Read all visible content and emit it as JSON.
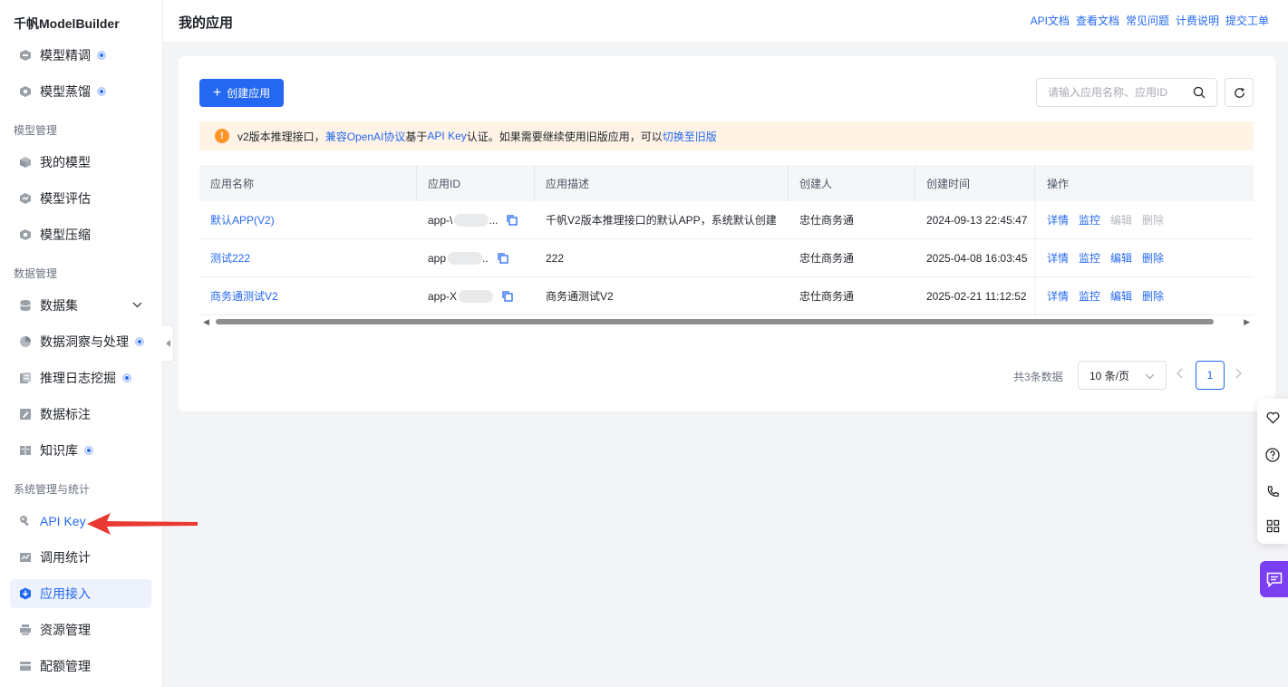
{
  "sidebar": {
    "brand": "千帆ModelBuilder",
    "top_items": [
      {
        "label": "模型精调",
        "badge": true
      },
      {
        "label": "模型蒸馏",
        "badge": true
      }
    ],
    "groups": [
      {
        "title": "模型管理",
        "items": [
          {
            "label": "我的模型"
          },
          {
            "label": "模型评估"
          },
          {
            "label": "模型压缩"
          }
        ]
      },
      {
        "title": "数据管理",
        "items": [
          {
            "label": "数据集",
            "expandable": true
          },
          {
            "label": "数据洞察与处理",
            "badge": true
          },
          {
            "label": "推理日志挖掘",
            "badge": true
          },
          {
            "label": "数据标注"
          },
          {
            "label": "知识库",
            "badge": true
          }
        ]
      },
      {
        "title": "系统管理与统计",
        "items": [
          {
            "label": "API Key"
          },
          {
            "label": "调用统计"
          },
          {
            "label": "应用接入",
            "active": true
          },
          {
            "label": "资源管理"
          },
          {
            "label": "配额管理"
          }
        ]
      }
    ]
  },
  "header": {
    "title": "我的应用",
    "links": [
      "API文档",
      "查看文档",
      "常见问题",
      "计费说明",
      "提交工单"
    ]
  },
  "toolbar": {
    "create_label": "创建应用",
    "search_placeholder": "请输入应用名称、应用ID"
  },
  "notice": {
    "part1": "v2版本推理接口，",
    "link1": "兼容OpenAI协议",
    "part2": "基于",
    "link2": "API Key",
    "part3": "认证。如果需要继续使用旧版应用，可以",
    "link3": "切换至旧版"
  },
  "table": {
    "columns": [
      "应用名称",
      "应用ID",
      "应用描述",
      "创建人",
      "创建时间",
      "操作"
    ],
    "rows": [
      {
        "name": "默认APP(V2)",
        "id_prefix": "app-\\",
        "id_suffix": "...",
        "desc": "千帆V2版本推理接口的默认APP，系统默认创建",
        "creator": "忠仕商务通",
        "created": "2024-09-13 22:45:47",
        "ops": [
          "详情",
          "监控",
          "编辑",
          "删除"
        ],
        "ops_disabled": [
          false,
          false,
          true,
          true
        ]
      },
      {
        "name": "测试222",
        "id_prefix": "app",
        "id_suffix": "..",
        "desc": "222",
        "creator": "忠仕商务通",
        "created": "2025-04-08 16:03:45",
        "ops": [
          "详情",
          "监控",
          "编辑",
          "删除"
        ],
        "ops_disabled": [
          false,
          false,
          false,
          false
        ]
      },
      {
        "name": "商务通测试V2",
        "id_prefix": "app-X",
        "id_suffix": "",
        "desc": "商务通测试V2",
        "creator": "忠仕商务通",
        "created": "2025-02-21 11:12:52",
        "ops": [
          "详情",
          "监控",
          "编辑",
          "删除"
        ],
        "ops_disabled": [
          false,
          false,
          false,
          false
        ]
      }
    ]
  },
  "pagination": {
    "total": "共3条数据",
    "page_size": "10 条/页",
    "current_page": "1"
  },
  "colors": {
    "accent": "#2468f2",
    "warning": "#ff9326",
    "chat": "#7b3ff2",
    "annotation_arrow": "#e83a32"
  }
}
